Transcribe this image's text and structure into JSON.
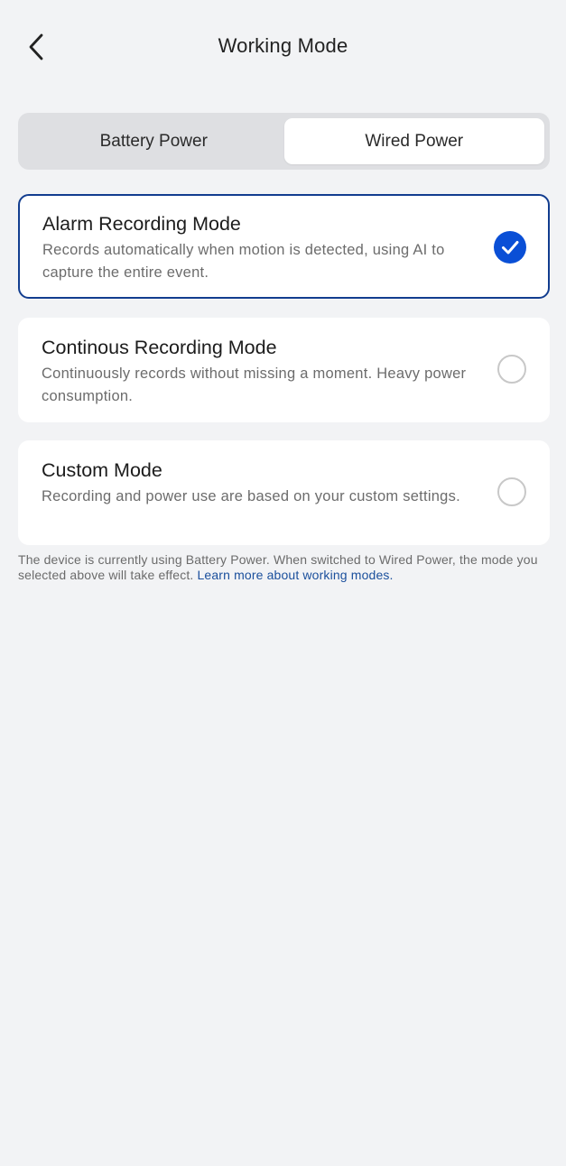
{
  "header": {
    "title": "Working Mode",
    "back_icon": "chevron-left-icon"
  },
  "power_tabs": {
    "items": [
      {
        "label": "Battery Power",
        "active": false
      },
      {
        "label": "Wired Power",
        "active": true
      }
    ]
  },
  "modes": [
    {
      "title": "Alarm Recording Mode",
      "description": "Records automatically when motion is detected, using AI to capture the entire event.",
      "selected": true,
      "icon": "checkmark-circle-icon"
    },
    {
      "title": "Continous Recording Mode",
      "description": "Continuously records without missing a moment. Heavy power consumption.",
      "selected": false,
      "icon": "radio-unchecked-icon"
    },
    {
      "title": "Custom Mode",
      "description": "Recording and power use are based on your custom settings.",
      "selected": false,
      "icon": "radio-unchecked-icon"
    }
  ],
  "footer": {
    "note": "The device is currently using Battery Power. When switched to Wired Power, the mode you selected above will take effect. ",
    "link": "Learn more about working modes."
  },
  "colors": {
    "background": "#f2f3f5",
    "accent": "#0a4fd6",
    "selected_border": "#123d8f",
    "link": "#1a4f9c"
  }
}
